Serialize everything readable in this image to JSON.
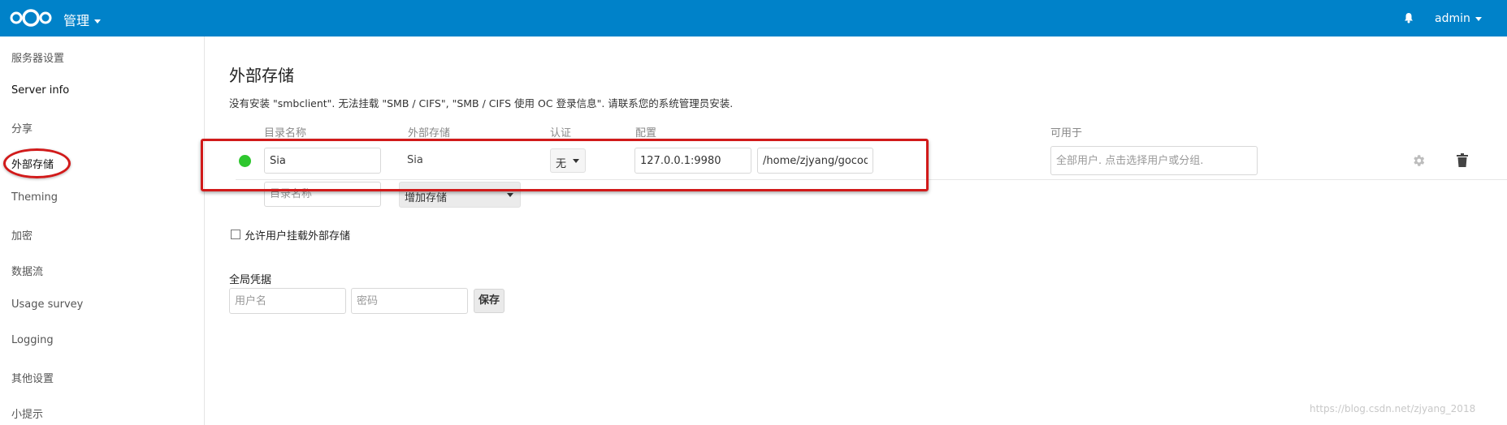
{
  "header": {
    "app_name": "管理",
    "user": "admin",
    "logo_icon": "nextcloud-logo-icon",
    "bell_icon": "bell-icon",
    "colors": {
      "header": "#0082c9",
      "status_ok": "#2ec72e",
      "highlight": "#d11a1a"
    }
  },
  "sidebar": {
    "items": [
      {
        "label": "服务器设置"
      },
      {
        "label": "Server info"
      },
      {
        "label": "分享"
      },
      {
        "label": "外部存储"
      },
      {
        "label": "Theming"
      },
      {
        "label": "加密"
      },
      {
        "label": "数据流"
      },
      {
        "label": "Usage survey"
      },
      {
        "label": "Logging"
      },
      {
        "label": "其他设置"
      },
      {
        "label": "小提示"
      }
    ],
    "active_index": 3
  },
  "main": {
    "title": "外部存储",
    "notice": "没有安装 \"smbclient\". 无法挂载 \"SMB / CIFS\", \"SMB / CIFS 使用 OC 登录信息\". 请联系您的系统管理员安装.",
    "columns": {
      "folder": "目录名称",
      "external": "外部存储",
      "auth": "认证",
      "config": "配置",
      "available": "可用于"
    },
    "mount": {
      "folder_value": "Sia",
      "storage": "Sia",
      "auth": "无",
      "host_value": "127.0.0.1:9980",
      "path_value": "/home/zjyang/gocode",
      "available_placeholder": "全部用户. 点击选择用户或分组.",
      "gear_icon": "gear-icon",
      "trash_icon": "trash-icon"
    },
    "new_mount": {
      "folder_placeholder": "目录名称",
      "add_label": "增加存储"
    },
    "allow_user_mount": "允许用户挂载外部存储",
    "global_creds": {
      "label": "全局凭据",
      "user_placeholder": "用户名",
      "password_placeholder": "密码",
      "save_label": "保存"
    }
  },
  "watermark": "https://blog.csdn.net/zjyang_2018"
}
